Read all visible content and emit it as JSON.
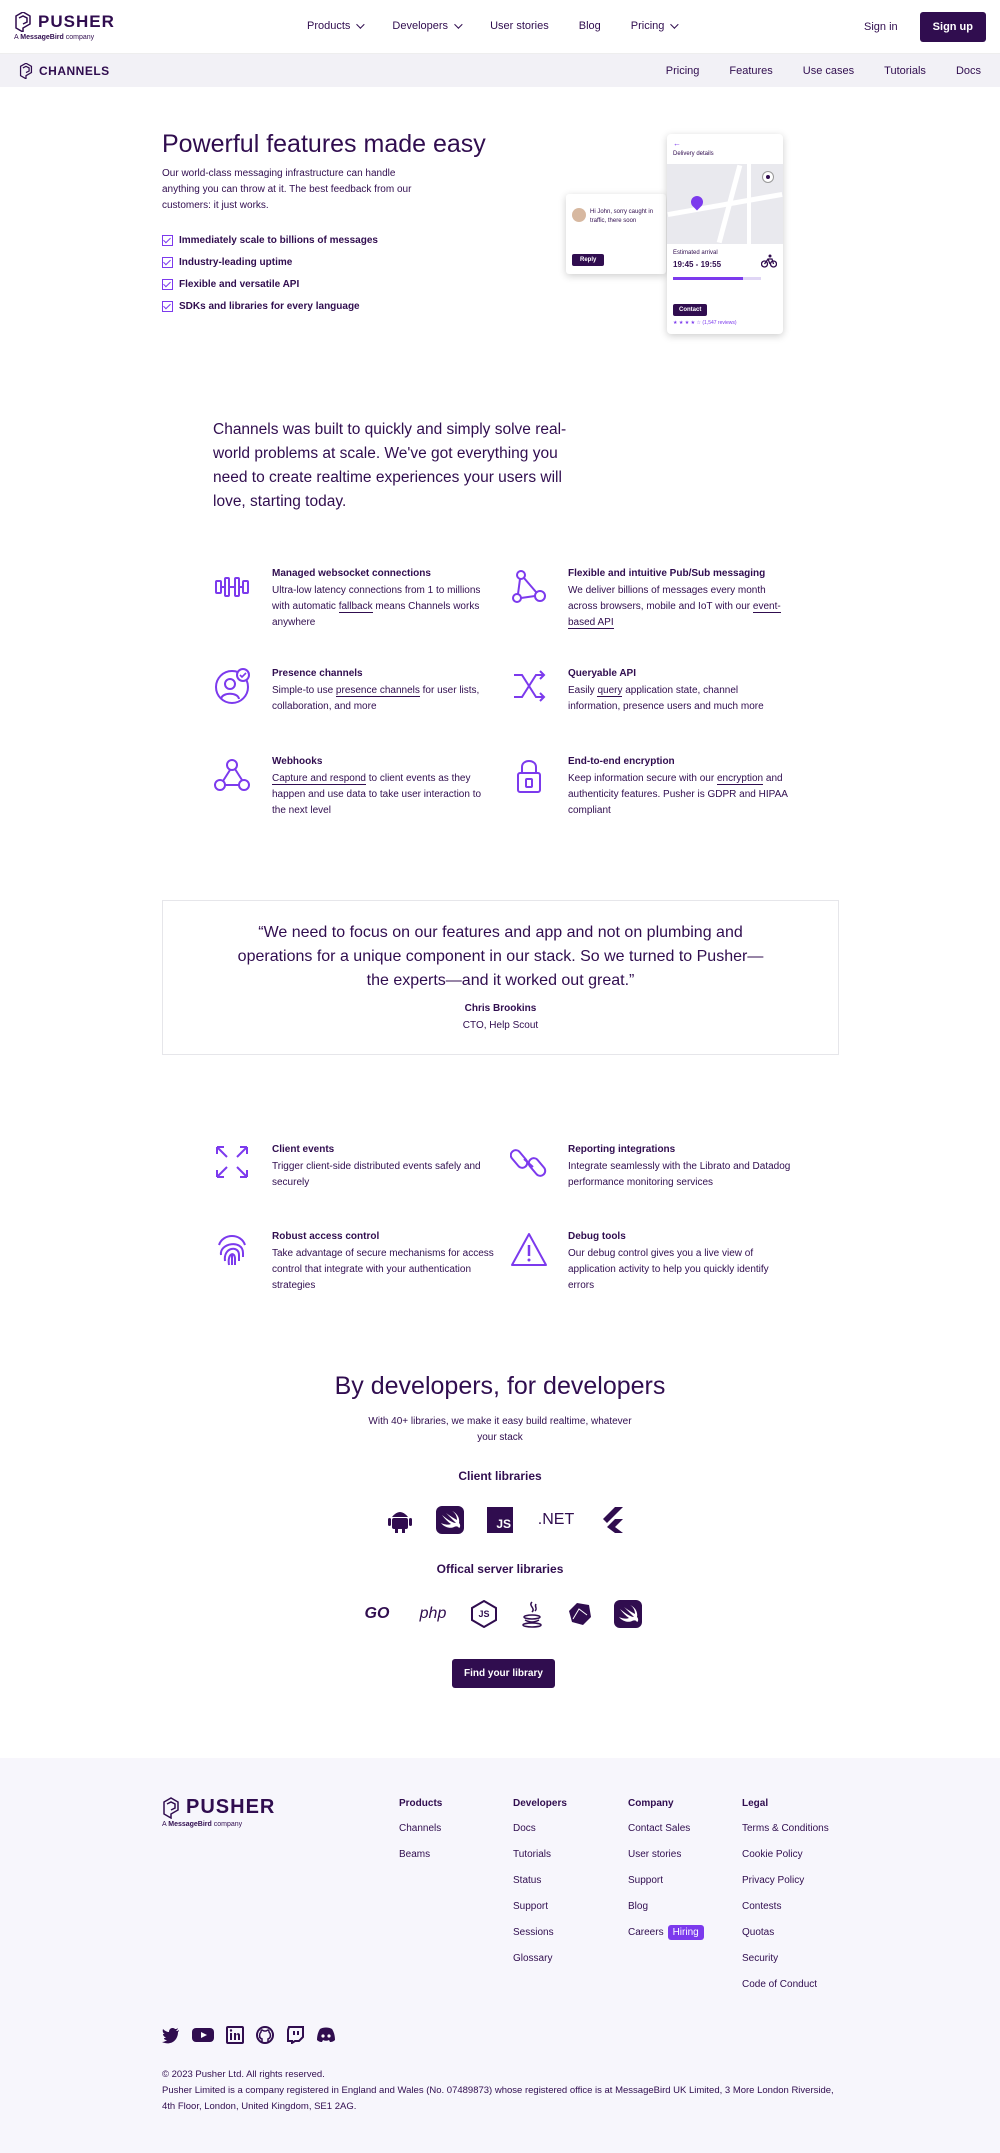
{
  "brand": {
    "name": "PUSHER",
    "tagline_prefix": "A ",
    "tagline_bold": "MessageBird",
    "tagline_suffix": " company"
  },
  "topnav": {
    "items": [
      "Products",
      "Developers",
      "User stories",
      "Blog",
      "Pricing"
    ],
    "sign_in": "Sign in",
    "sign_up": "Sign up"
  },
  "subnav": {
    "brand": "CHANNELS",
    "links": [
      "Pricing",
      "Features",
      "Use cases",
      "Tutorials",
      "Docs"
    ]
  },
  "hero": {
    "title": "Powerful features made easy",
    "description": "Our world-class messaging infrastructure can handle anything you can throw at it. The best feedback from our customers: it just works.",
    "bullets": [
      "Immediately scale to billions of messages",
      "Industry-leading uptime",
      "Flexible and versatile API",
      "SDKs and libraries for every language"
    ],
    "illustration": {
      "back": "←",
      "delivery": "Delivery details",
      "eta_label": "Estimated arrival",
      "eta_time": "19:45 - 19:55",
      "eta_progress": 0.8,
      "contact": "Contact",
      "stars": "★ ★ ★ ★ ☆",
      "reviews": "(1,547 reviews)",
      "chat": "Hi John, sorry caught in traffic, there soon",
      "reply": "Reply"
    }
  },
  "intro": "Channels was built to quickly and simply solve real-world problems at scale. We've got everything you need to create realtime experiences your users will love, starting today.",
  "features": [
    {
      "title": "Managed websocket connections",
      "pre": "Ultra-low latency connections from 1 to millions with automatic ",
      "link": "fallback",
      "post": " means Channels works anywhere",
      "icon": "websocket-icon"
    },
    {
      "title": "Flexible and intuitive Pub/Sub messaging",
      "pre": "We deliver billions of messages every month across browsers, mobile and IoT with our ",
      "link": "event-based API",
      "post": "",
      "icon": "pubsub-icon"
    },
    {
      "title": "Presence channels",
      "pre": "Simple-to use ",
      "link": "presence channels",
      "post": " for user lists, collaboration, and more",
      "icon": "presence-icon"
    },
    {
      "title": "Queryable API",
      "pre": "Easily ",
      "link": "query",
      "post": " application state, channel information, presence users and much more",
      "icon": "shuffle-icon"
    },
    {
      "title": "Webhooks",
      "pre": "",
      "link": "Capture and respond",
      "post": " to client events as they happen and use data to take user interaction to the next level",
      "icon": "webhook-icon"
    },
    {
      "title": "End-to-end encryption",
      "pre": "Keep information secure with our ",
      "link": "encryption",
      "post": " and authenticity features. Pusher is GDPR and HIPAA compliant",
      "icon": "lock-icon"
    }
  ],
  "quote": {
    "text": "“We need to focus on our features and app and not on plumbing and operations for a unique component in our stack. So we turned to Pusher—the experts—and it worked out great.”",
    "name": "Chris Brookins",
    "role": "CTO, Help Scout"
  },
  "features2": [
    {
      "title": "Client events",
      "text": "Trigger client-side distributed events safely and securely",
      "icon": "expand-icon"
    },
    {
      "title": "Reporting integrations",
      "text": "Integrate seamlessly with the Librato and Datadog performance monitoring services",
      "icon": "link-icon"
    },
    {
      "title": "Robust access control",
      "text": "Take advantage of secure mechanisms for access control that integrate with your authentication strategies",
      "icon": "fingerprint-icon"
    },
    {
      "title": "Debug tools",
      "text": "Our debug control gives you a live view of application activity to help you quickly identify errors",
      "icon": "warning-icon"
    }
  ],
  "developers": {
    "title": "By developers, for developers",
    "subtitle": "With 40+ libraries, we make it easy build realtime, whatever your stack",
    "client_heading": "Client libraries",
    "client_libs": [
      "android-icon",
      "swift-icon",
      "JS",
      ".NET",
      "flutter-icon"
    ],
    "server_heading": "Offical server libraries",
    "server_libs": [
      "GO",
      "php",
      "JS",
      "java-icon",
      "ruby-icon",
      "swift-icon"
    ],
    "cta": "Find your library"
  },
  "footer": {
    "columns": [
      {
        "title": "Products",
        "items": [
          "Channels",
          "Beams"
        ]
      },
      {
        "title": "Developers",
        "items": [
          "Docs",
          "Tutorials",
          "Status",
          "Support",
          "Sessions",
          "Glossary"
        ]
      },
      {
        "title": "Company",
        "items": [
          "Contact Sales",
          "User stories",
          "Support",
          "Blog",
          "Careers"
        ]
      },
      {
        "title": "Legal",
        "items": [
          "Terms & Conditions",
          "Cookie Policy",
          "Privacy Policy",
          "Contests",
          "Quotas",
          "Security",
          "Code of Conduct"
        ]
      }
    ],
    "hiring": "Hiring",
    "socials": [
      "twitter-icon",
      "youtube-icon",
      "linkedin-icon",
      "github-icon",
      "twitch-icon",
      "discord-icon"
    ],
    "copyright": "© 2023 Pusher Ltd. All rights reserved.",
    "legal": "Pusher Limited is a company registered in England and Wales (No. 07489873) whose registered office is at MessageBird UK Limited, 3 More London Riverside, 4th Floor, London, United Kingdom, SE1 2AG."
  },
  "colors": {
    "primary": "#300d4f",
    "accent": "#7c3aed",
    "footer_bg": "#f7f6fc"
  }
}
